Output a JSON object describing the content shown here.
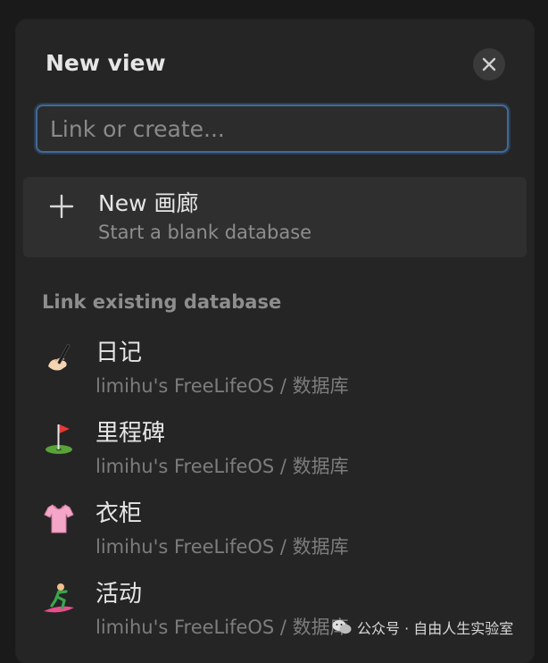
{
  "dialog": {
    "title": "New view",
    "close_icon": "close-icon"
  },
  "search": {
    "placeholder": "Link or create...",
    "value": ""
  },
  "new_option": {
    "icon": "plus-icon",
    "title": "New 画廊",
    "subtitle": "Start a blank database"
  },
  "section": {
    "label": "Link existing database"
  },
  "databases": [
    {
      "name": "日记",
      "path": "limihu's FreeLifeOS / 数据库",
      "icon": "writing-hand-icon"
    },
    {
      "name": "里程碑",
      "path": "limihu's FreeLifeOS / 数据库",
      "icon": "golf-flag-icon"
    },
    {
      "name": "衣柜",
      "path": "limihu's FreeLifeOS / 数据库",
      "icon": "shirt-icon"
    },
    {
      "name": "活动",
      "path": "limihu's FreeLifeOS / 数据库",
      "icon": "surfer-icon"
    }
  ],
  "watermark": {
    "text": "公众号 · 自由人生实验室",
    "icon": "wechat-icon"
  },
  "colors": {
    "panel_bg": "#252525",
    "focus_border": "#3f6a99"
  }
}
